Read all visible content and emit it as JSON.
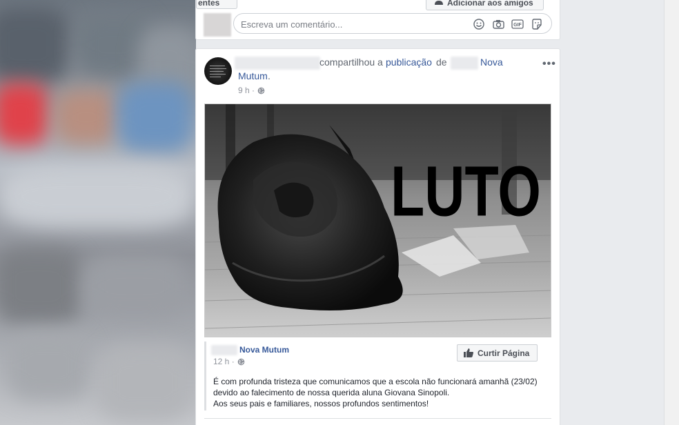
{
  "top": {
    "dropdown_label": "entes",
    "add_friend_label": "Adicionar aos amigos",
    "comment_placeholder": "Escreva um comentário...",
    "comment_icons": [
      "emoji-icon",
      "camera-icon",
      "gif-icon",
      "sticker-icon"
    ]
  },
  "post": {
    "shared_text": "compartilhou a",
    "publication_link": "publicação",
    "of_text": "de",
    "page_name_part1": "Nova",
    "page_name_part2": "Mutum",
    "period": ".",
    "time": "9 h ·",
    "more_label": "•••",
    "photo_text": "LUTO"
  },
  "shared": {
    "page_name": "Nova Mutum",
    "time": "12 h ·",
    "like_page_label": "Curtir Página",
    "lines": [
      "É com profunda tristeza que comunicamos que a escola não funcionará amanhã (23/02)",
      "devido ao falecimento de nossa querida aluna Giovana Sinopoli.",
      "Aos seus pais e familiares, nossos profundos sentimentos!"
    ]
  },
  "colors": {
    "link": "#365899",
    "meta": "#90949c",
    "background": "#e9ebee"
  }
}
